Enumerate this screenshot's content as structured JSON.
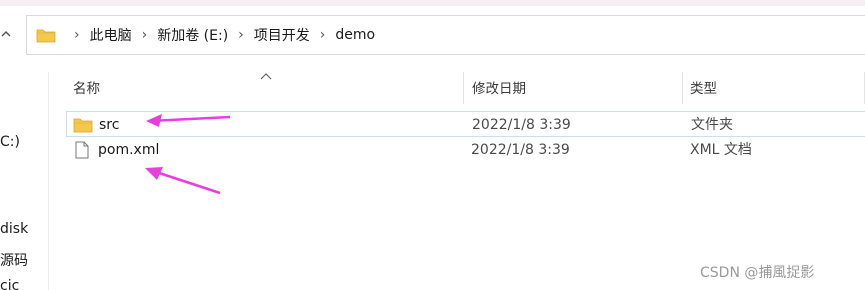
{
  "address_bar": {
    "breadcrumbs": [
      "此电脑",
      "新加卷 (E:)",
      "项目开发",
      "demo"
    ]
  },
  "left_pane": {
    "fragments": [
      "C:)",
      "disk",
      "源码",
      "cic"
    ]
  },
  "columns": {
    "name": "名称",
    "date": "修改日期",
    "type": "类型"
  },
  "files": [
    {
      "name": "src",
      "date": "2022/1/8 3:39",
      "type": "文件夹",
      "icon": "folder-icon"
    },
    {
      "name": "pom.xml",
      "date": "2022/1/8 3:39",
      "type": "XML 文档",
      "icon": "document-icon"
    }
  ],
  "watermark": "CSDN @捕風捉影",
  "colors": {
    "folder": "#f2c94c",
    "selection_border": "#c9dff4",
    "arrow": "#e83ee0"
  }
}
